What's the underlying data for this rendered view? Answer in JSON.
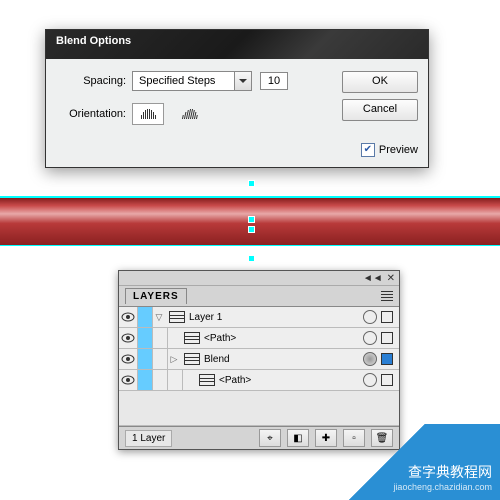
{
  "dialog": {
    "title": "Blend Options",
    "spacing_label": "Spacing:",
    "spacing_mode": "Specified Steps",
    "steps_value": "10",
    "orientation_label": "Orientation:",
    "ok": "OK",
    "cancel": "Cancel",
    "preview_label": "Preview",
    "preview_checked": true
  },
  "layers": {
    "panel_title": "LAYERS",
    "count_label": "1 Layer",
    "rows": [
      {
        "name": "Layer 1",
        "indent": 0,
        "expanded": true,
        "target": "hollow",
        "select": true
      },
      {
        "name": "<Path>",
        "indent": 1,
        "expanded": null,
        "target": "hollow",
        "select": false
      },
      {
        "name": "Blend",
        "indent": 1,
        "expanded": false,
        "target": "fill",
        "select": true,
        "selbox": true
      },
      {
        "name": "<Path>",
        "indent": 2,
        "expanded": null,
        "target": "hollow",
        "select": false
      }
    ]
  },
  "watermark": {
    "main": "查字典教程网",
    "sub": "jiaocheng.chazidian.com"
  }
}
